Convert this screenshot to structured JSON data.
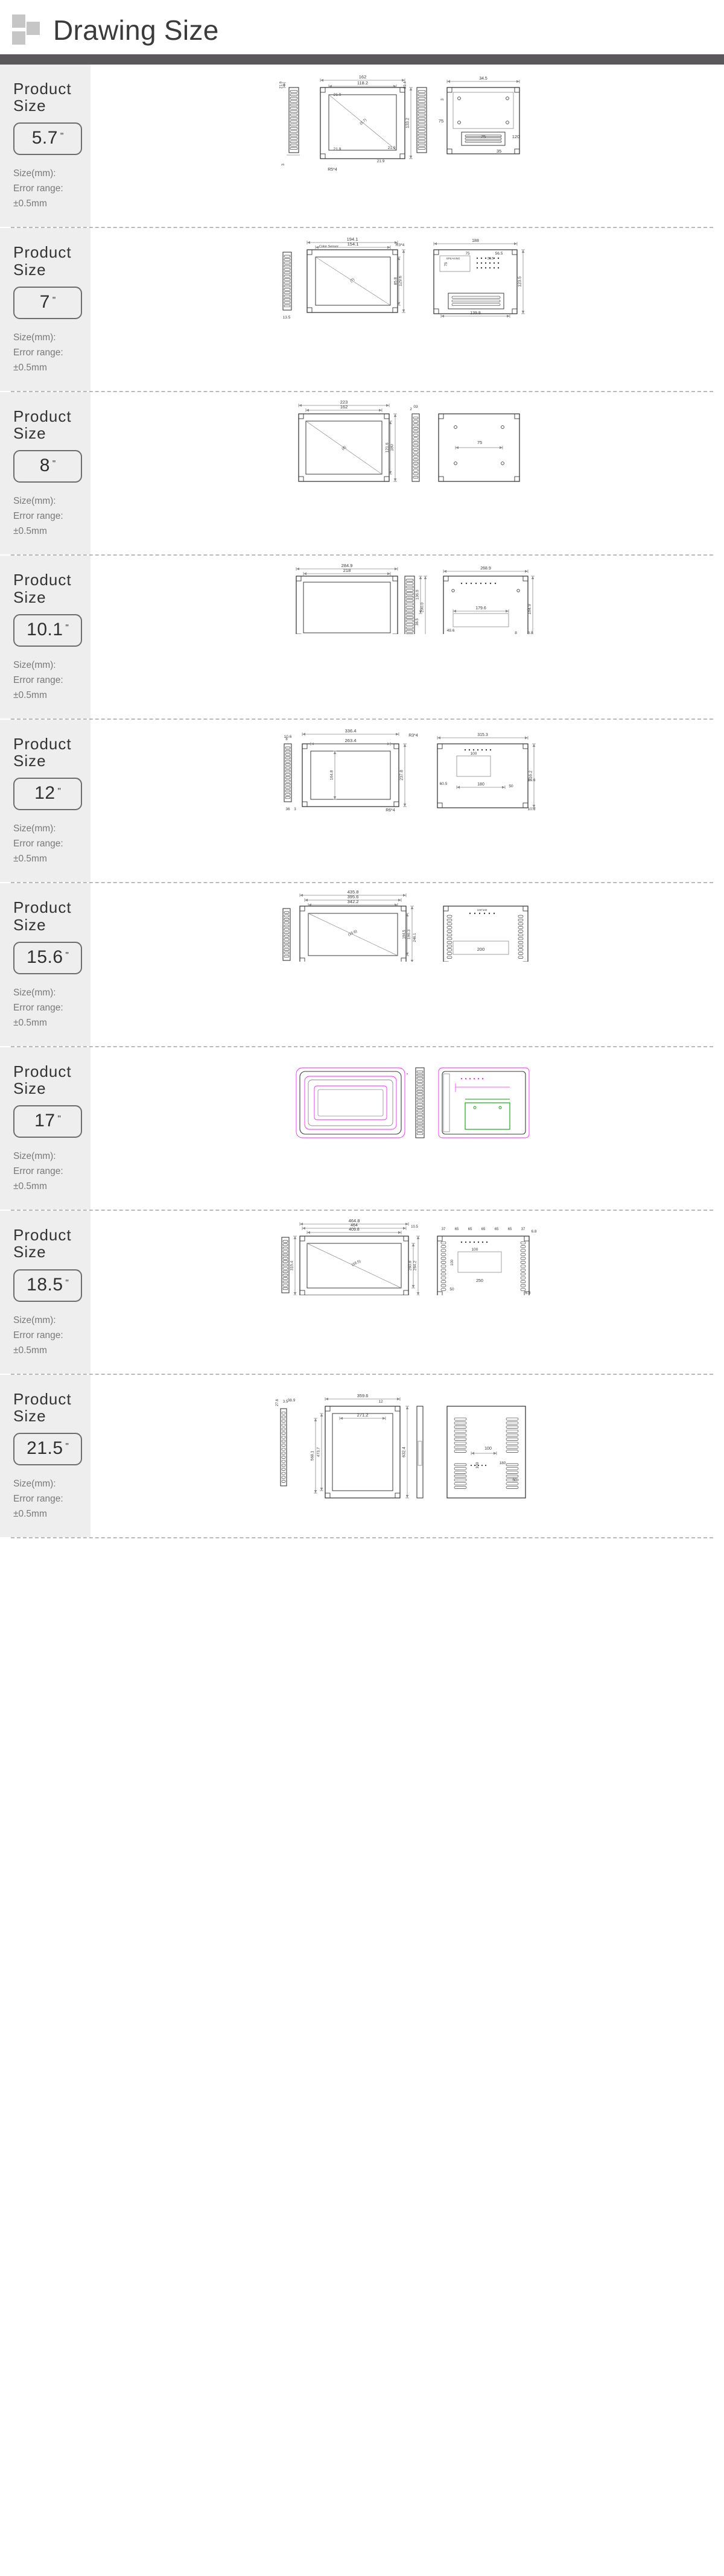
{
  "header": {
    "title": "Drawing Size",
    "logo_icon": "squares-logo-icon"
  },
  "labels": {
    "product_size": "Product\nSize",
    "product_word_1": "Product",
    "product_word_2": "Size",
    "size_mm": "Size(mm):",
    "error_range": "Error range:",
    "tolerance": "±0.5mm",
    "inch_mark": "\""
  },
  "colors": {
    "header_text": "#3b3b3b",
    "header_rule": "#5a585a",
    "logo": "#c6c6c6",
    "label_bg": "#eeeeee",
    "meta_text": "#787878",
    "cad_line": "#3a3a3a",
    "cad_thin": "#8a8a8a",
    "cad_magenta": "#ff22ff",
    "cad_green": "#00a000",
    "separator": "#b9b9b9"
  },
  "products": [
    {
      "size": "5.7",
      "unit": "\"",
      "front_dims": [
        "162",
        "118.2",
        "21.9",
        "21.9",
        "21.9",
        "21.9",
        "133.2",
        "89.4",
        "5.7",
        "R5*4"
      ],
      "side_dims": [
        "3"
      ],
      "back_dims": [
        "34.5",
        "3",
        "75",
        "75",
        "120",
        "35"
      ],
      "views": [
        "side-left",
        "front",
        "side-right",
        "back"
      ]
    },
    {
      "size": "7",
      "unit": "\"",
      "front_dims": [
        "194.1",
        "154.1",
        "129.6",
        "85.8",
        "13.5",
        "R3*4",
        "7",
        "Color Sensor"
      ],
      "side_dims": [],
      "back_dims": [
        "188",
        "139.8",
        "123.5",
        "75",
        "75",
        "56.5",
        "36.5",
        "SPEAKING"
      ],
      "views": [
        "side-left",
        "front",
        "back"
      ]
    },
    {
      "size": "8",
      "unit": "\"",
      "front_dims": [
        "223",
        "162",
        "180",
        "121.6",
        "8.0",
        "03",
        "2",
        "75"
      ],
      "side_dims": [],
      "back_dims": [
        "75"
      ],
      "views": [
        "front",
        "side",
        "back"
      ]
    },
    {
      "size": "10.1",
      "unit": "\"",
      "front_dims": [
        "284.9",
        "218",
        "136.0",
        "200.0",
        "36.5",
        "10.8",
        "R3*4"
      ],
      "side_dims": [],
      "back_dims": [
        "268.9",
        "179.6",
        "184.9",
        "49.6",
        "8",
        "8.8"
      ],
      "views": [
        "front",
        "side",
        "back"
      ]
    },
    {
      "size": "12",
      "unit": "\"",
      "front_dims": [
        "336.4",
        "263.4",
        "164.8",
        "237.8",
        "10.6",
        "8",
        "36",
        "3",
        "R3*4",
        "R6*4"
      ],
      "side_dims": [],
      "back_dims": [
        "315.3",
        "216.2",
        "180",
        "100",
        "100",
        "60.5",
        "50",
        "10.6",
        "10.6"
      ],
      "views": [
        "front",
        "back"
      ]
    },
    {
      "size": "15.6",
      "unit": "\"",
      "front_dims": [
        "435.8",
        "395.6",
        "342.2",
        "133.5",
        "196.3",
        "194.5",
        "246.1",
        "40",
        "10.1"
      ],
      "side_dims": [],
      "back_dims": [
        "200",
        "100*100"
      ],
      "views": [
        "side-left",
        "front",
        "back"
      ]
    },
    {
      "size": "17",
      "unit": "\"",
      "front_dims": [],
      "side_dims": [],
      "back_dims": [],
      "views": [
        "front-cad",
        "side-cad",
        "back-cad"
      ],
      "style": "color-cad"
    },
    {
      "size": "18.5",
      "unit": "\"",
      "front_dims": [
        "464.8",
        "464",
        "409.8",
        "315.4",
        "116.5",
        "470.7",
        "260.8",
        "264.2",
        "494.8",
        "10.5"
      ],
      "side_dims": [],
      "back_dims": [
        "37",
        "65",
        "65",
        "65",
        "65",
        "65",
        "37",
        "100",
        "100",
        "250",
        "50",
        "6.8",
        "6.8"
      ],
      "views": [
        "side-left",
        "front",
        "back"
      ]
    },
    {
      "size": "21.5",
      "unit": "\"",
      "front_dims": [
        "359.6",
        "271.2",
        "473.7",
        "632.4",
        "568.1",
        "27.6",
        "38.9",
        "12",
        "3.5"
      ],
      "side_dims": [],
      "back_dims": [
        "100",
        "100",
        "180",
        "50"
      ],
      "views": [
        "side-left",
        "front",
        "side-mid",
        "back"
      ]
    }
  ]
}
